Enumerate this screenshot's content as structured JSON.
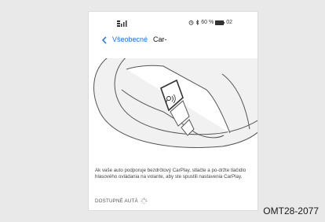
{
  "status_bar": {
    "signal_icon": "cellular-signal-icon",
    "alarm_icon": "alarm-icon",
    "bluetooth_icon": "bluetooth-icon",
    "battery_text": "60 %",
    "battery_icon": "battery-icon",
    "time": "02"
  },
  "nav": {
    "back_icon": "chevron-left-icon",
    "back_label": "Všeobecné",
    "title": "Car-"
  },
  "illustration": {
    "subject": "steering-wheel-voice-button",
    "voice_icon": "voice-command-icon"
  },
  "content": {
    "instruction": "Ak vaše auto podporuje bezdrôtový CarPlay, stlačte a po-držte tlačidlo hlasového ovládania na volante, aby ste spustili nastavenia CarPlay.",
    "available_label": "DOSTUPNÉ AUTÁ",
    "spinner_icon": "loading-spinner-icon"
  },
  "figure_code": "OMT28-2077",
  "colors": {
    "accent": "#1a73e8",
    "background": "#e9e9e9"
  }
}
